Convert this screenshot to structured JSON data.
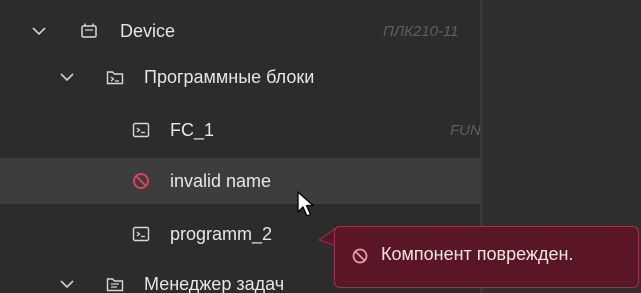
{
  "tree": {
    "device": {
      "label": "Device",
      "subtitle": "ПЛК210-11",
      "icon": "device-icon"
    },
    "program_blocks": {
      "label": "Программные блоки",
      "icon": "folder-code-icon"
    },
    "fc1": {
      "label": "FC_1",
      "subtitle": "FUN",
      "icon": "terminal-icon"
    },
    "invalid": {
      "label": "invalid name",
      "icon": "prohibited-icon"
    },
    "programm2": {
      "label": "programm_2",
      "icon": "terminal-icon"
    },
    "task_manager": {
      "label": "Менеджер задач",
      "icon": "task-folder-icon"
    }
  },
  "tooltip": {
    "text": "Компонент поврежден.",
    "icon": "prohibited-icon"
  },
  "colors": {
    "error": "#e0405e",
    "tooltip_bg": "#5b1626",
    "selected_row": "#3d3d3d",
    "text": "#e6e6e6"
  }
}
